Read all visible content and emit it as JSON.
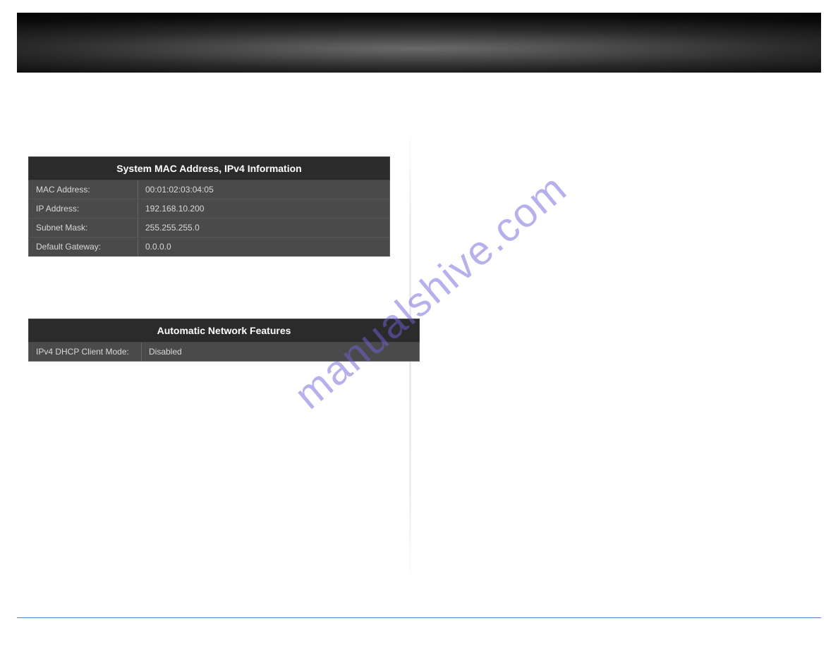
{
  "watermark": "manualshive.com",
  "systemInfo": {
    "title": "System MAC Address, IPv4 Information",
    "rows": [
      {
        "label": "MAC Address:",
        "value": "00:01:02:03:04:05"
      },
      {
        "label": "IP Address:",
        "value": "192.168.10.200"
      },
      {
        "label": "Subnet Mask:",
        "value": "255.255.255.0"
      },
      {
        "label": "Default Gateway:",
        "value": "0.0.0.0"
      }
    ]
  },
  "networkFeatures": {
    "title": "Automatic Network Features",
    "rows": [
      {
        "label": "IPv4 DHCP Client Mode:",
        "value": "Disabled"
      }
    ]
  }
}
